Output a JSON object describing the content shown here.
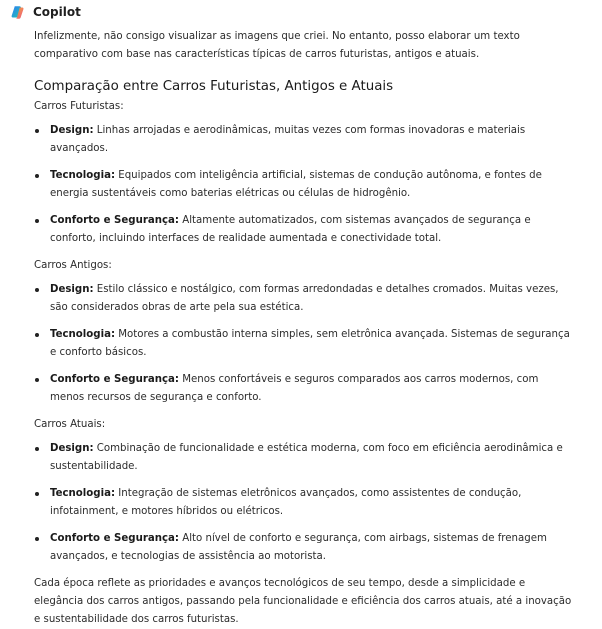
{
  "app": {
    "name": "Copilot",
    "logo_icon": "copilot-logo-icon"
  },
  "message": {
    "intro": "Infelizmente, não consigo visualizar as imagens que criei. No entanto, posso elaborar um texto comparativo com base nas características típicas de carros futuristas, antigos e atuais.",
    "heading": "Comparação entre Carros Futuristas, Antigos e Atuais",
    "sections": [
      {
        "title": "Carros Futuristas:",
        "points": [
          {
            "term": "Design:",
            "text": " Linhas arrojadas e aerodinâmicas, muitas vezes com formas inovadoras e materiais avançados."
          },
          {
            "term": "Tecnologia:",
            "text": " Equipados com inteligência artificial, sistemas de condução autônoma, e fontes de energia sustentáveis como baterias elétricas ou células de hidrogênio."
          },
          {
            "term": "Conforto e Segurança:",
            "text": " Altamente automatizados, com sistemas avançados de segurança e conforto, incluindo interfaces de realidade aumentada e conectividade total."
          }
        ]
      },
      {
        "title": "Carros Antigos:",
        "points": [
          {
            "term": "Design:",
            "text": " Estilo clássico e nostálgico, com formas arredondadas e detalhes cromados. Muitas vezes, são considerados obras de arte pela sua estética."
          },
          {
            "term": "Tecnologia:",
            "text": " Motores a combustão interna simples, sem eletrônica avançada. Sistemas de segurança e conforto básicos."
          },
          {
            "term": "Conforto e Segurança:",
            "text": " Menos confortáveis e seguros comparados aos carros modernos, com menos recursos de segurança e conforto."
          }
        ]
      },
      {
        "title": "Carros Atuais:",
        "points": [
          {
            "term": "Design:",
            "text": " Combinação de funcionalidade e estética moderna, com foco em eficiência aerodinâmica e sustentabilidade."
          },
          {
            "term": "Tecnologia:",
            "text": " Integração de sistemas eletrônicos avançados, como assistentes de condução, infotainment, e motores híbridos ou elétricos."
          },
          {
            "term": "Conforto e Segurança:",
            "text": " Alto nível de conforto e segurança, com airbags, sistemas de frenagem avançados, e tecnologias de assistência ao motorista."
          }
        ]
      }
    ],
    "conclusion": "Cada época reflete as prioridades e avanços tecnológicos de seu tempo, desde a simplicidade e elegância dos carros antigos, passando pela funcionalidade e eficiência dos carros atuais, até a inovação e sustentabilidade dos carros futuristas."
  }
}
